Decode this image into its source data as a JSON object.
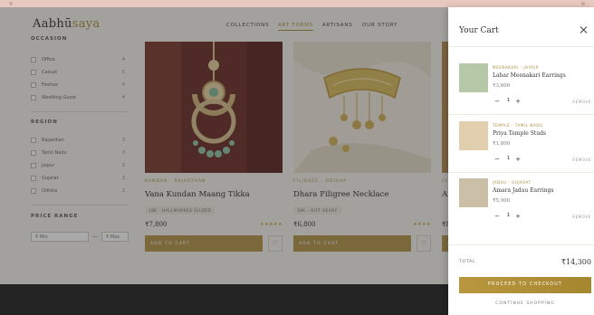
{
  "brand": {
    "name_prefix": "Aabhū",
    "name_accent": "saya"
  },
  "nav": {
    "items": [
      "COLLECTIONS",
      "ART FORMS",
      "ARTISANS",
      "OUR STORY"
    ],
    "active_index": 1
  },
  "sidebar": {
    "occasion": {
      "title": "OCCASION",
      "options": [
        {
          "label": "Office",
          "count": "4"
        },
        {
          "label": "Casual",
          "count": "5"
        },
        {
          "label": "Festive",
          "count": "4"
        },
        {
          "label": "Wedding Guest",
          "count": "4"
        }
      ]
    },
    "region": {
      "title": "REGION",
      "options": [
        {
          "label": "Rajasthan",
          "count": "3"
        },
        {
          "label": "Tamil Nadu",
          "count": "3"
        },
        {
          "label": "Jaipur",
          "count": "2"
        },
        {
          "label": "Gujarat",
          "count": "2"
        },
        {
          "label": "Odisha",
          "count": "2"
        }
      ]
    },
    "price": {
      "title": "PRICE RANGE",
      "min_placeholder": "₹ Min",
      "max_placeholder": "₹ Max",
      "separator": "—"
    }
  },
  "products": [
    {
      "meta": "KUNDAN · RAJASTHAN",
      "name": "Vana Kundan Maang Tikka",
      "tag": "18K · HALLMARKED GILDED",
      "price": "₹7,800",
      "stars": "★★★★★",
      "add_label": "ADD TO CART"
    },
    {
      "meta": "FILIGREE · ODISHA",
      "name": "Dhara Filigree Necklace",
      "tag": "18K · GIFT READY",
      "price": "₹6,800",
      "stars": "★★★★",
      "add_label": "ADD TO CART"
    },
    {
      "meta": "JHU",
      "name": "Ar",
      "tag": "",
      "price": "₹8",
      "stars": "",
      "add_label": "AD"
    }
  ],
  "cart": {
    "title": "Your Cart",
    "items": [
      {
        "variant": "MEENAKARI · JAIPUR",
        "name": "Lahar Meenakari Earrings",
        "price": "₹3,600",
        "qty": "1",
        "remove_label": "REMOVE",
        "color": "#b7c8a8"
      },
      {
        "variant": "TEMPLE · TAMIL NADU",
        "name": "Priya Temple Studs",
        "price": "₹1,800",
        "qty": "1",
        "remove_label": "REMOVE",
        "color": "#e2cfae"
      },
      {
        "variant": "JADAU · GUJARAT",
        "name": "Amara Jadau Earrings",
        "price": "₹5,900",
        "qty": "1",
        "remove_label": "REMOVE",
        "color": "#cbbfa8"
      }
    ],
    "total_label": "TOTAL",
    "total_value": "₹14,300",
    "checkout_label": "PROCEED TO CHECKOUT",
    "continue_label": "CONTINUE SHOPPING"
  },
  "colors": {
    "accent": "#a98c3b",
    "button": "#b2944a",
    "footer": "#222222"
  },
  "icons": {
    "close": "close-icon",
    "wishlist": "heart-icon",
    "minus": "minus-icon",
    "plus": "plus-icon"
  }
}
